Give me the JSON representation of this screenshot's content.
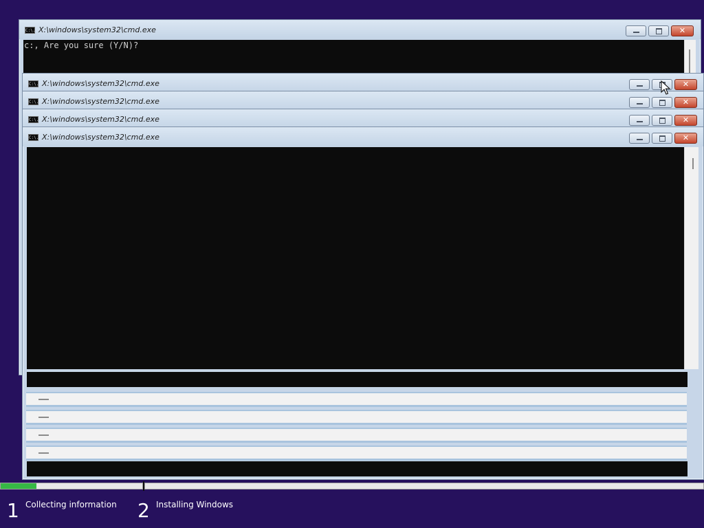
{
  "windows": [
    {
      "title": "X:\\windows\\system32\\cmd.exe",
      "console_text": "c:, Are you sure (Y/N)?"
    },
    {
      "title": "X:\\windows\\system32\\cmd.exe"
    },
    {
      "title": "X:\\windows\\system32\\cmd.exe"
    },
    {
      "title": "X:\\windows\\system32\\cmd.exe"
    },
    {
      "title": "X:\\windows\\system32\\cmd.exe"
    }
  ],
  "window_icon_text": "C:\\.",
  "controls": {
    "close_glyph": "✕"
  },
  "colors": {
    "desktop": "#26115d",
    "progress": "#36b845",
    "console": "#0c0c0c"
  },
  "setup": {
    "progress_fraction": 0.25,
    "steps": [
      {
        "number": "1",
        "label": "Collecting information"
      },
      {
        "number": "2",
        "label": "Installing Windows"
      }
    ]
  }
}
